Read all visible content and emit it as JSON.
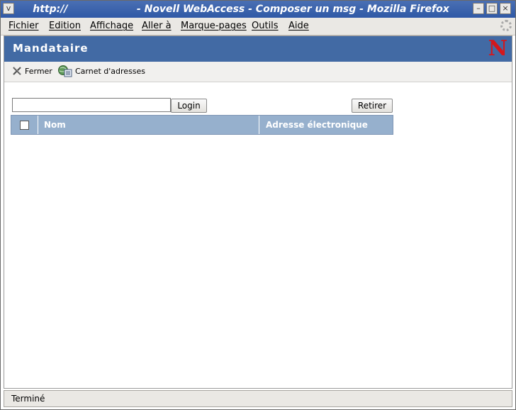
{
  "window": {
    "title": "http://                    - Novell WebAccess - Composer un msg - Mozilla Firefox",
    "menu_glyph": "v",
    "minimize_glyph": "–",
    "maximize_glyph": "□",
    "close_glyph": "×"
  },
  "menu": {
    "items": [
      "Fichier",
      "Edition",
      "Affichage",
      "Aller à",
      "Marque-pages",
      "Outils",
      "Aide"
    ]
  },
  "header": {
    "title": "Mandataire",
    "logo_text": "N",
    "logo_color": "#d4171c",
    "bg_color": "#426aa4"
  },
  "toolbar": {
    "close_label": "Fermer",
    "address_book_label": "Carnet d'adresses"
  },
  "form": {
    "login_value": "",
    "login_button": "Login",
    "remove_button": "Retirer"
  },
  "table": {
    "columns": [
      "Nom",
      "Adresse électronique"
    ],
    "rows": []
  },
  "status": {
    "text": "Terminé"
  }
}
